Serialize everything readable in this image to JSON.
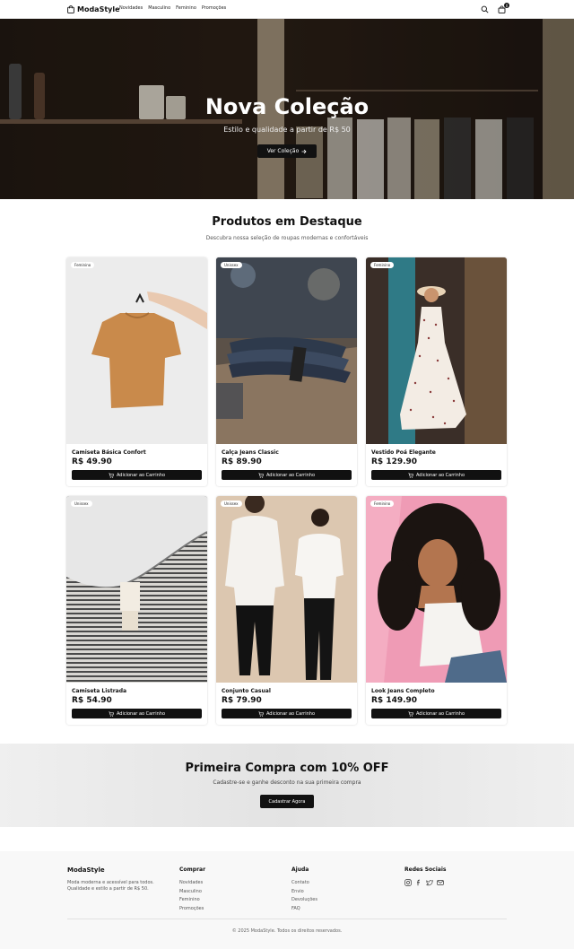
{
  "header": {
    "brand": "ModaStyle",
    "nav": [
      "Novidades",
      "Masculino",
      "Feminino",
      "Promoções"
    ],
    "cart_count": "0"
  },
  "hero": {
    "title": "Nova Coleção",
    "subtitle": "Estilo e qualidade a partir de R$ 50",
    "button": "Ver Coleção"
  },
  "featured": {
    "title": "Produtos em Destaque",
    "subtitle": "Descubra nossa seleção de roupas modernas e confortáveis",
    "add_label": "Adicionar ao Carrinho",
    "products": [
      {
        "tag": "Feminino",
        "name": "Camiseta Básica Confort",
        "price": "R$ 49.90"
      },
      {
        "tag": "Unissex",
        "name": "Calça Jeans Classic",
        "price": "R$ 89.90"
      },
      {
        "tag": "Feminino",
        "name": "Vestido Poá Elegante",
        "price": "R$ 129.90"
      },
      {
        "tag": "Unissex",
        "name": "Camiseta Listrada",
        "price": "R$ 54.90"
      },
      {
        "tag": "Unissex",
        "name": "Conjunto Casual",
        "price": "R$ 79.90"
      },
      {
        "tag": "Feminino",
        "name": "Look Jeans Completo",
        "price": "R$ 149.90"
      }
    ]
  },
  "promo": {
    "title": "Primeira Compra com 10% OFF",
    "subtitle": "Cadastre-se e ganhe desconto na sua primeira compra",
    "button": "Cadastrar Agora"
  },
  "footer": {
    "brand": "ModaStyle",
    "description": "Moda moderna e acessível para todos. Qualidade e estilo a partir de R$ 50.",
    "shop_title": "Comprar",
    "shop_links": [
      "Novidades",
      "Masculino",
      "Feminino",
      "Promoções"
    ],
    "help_title": "Ajuda",
    "help_links": [
      "Contato",
      "Envio",
      "Devoluções",
      "FAQ"
    ],
    "social_title": "Redes Sociais",
    "social_icons": [
      "instagram-icon",
      "facebook-icon",
      "twitter-icon",
      "mail-icon"
    ],
    "copyright": "© 2025 ModaStyle. Todos os direitos reservados."
  }
}
